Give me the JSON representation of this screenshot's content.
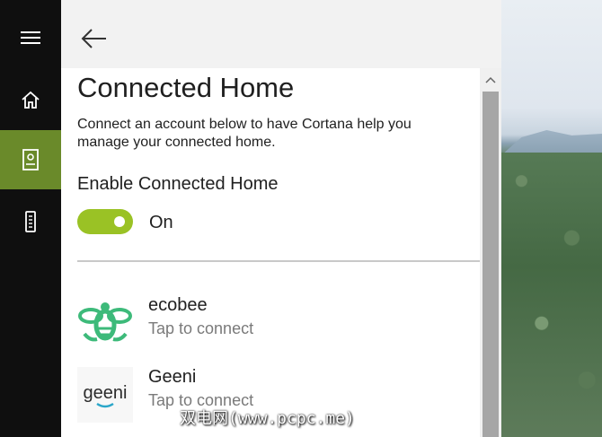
{
  "rail": {
    "items": [
      {
        "icon": "hamburger-menu-icon"
      },
      {
        "icon": "home-icon"
      },
      {
        "icon": "notebook-icon",
        "active": true
      },
      {
        "icon": "phone-icon"
      }
    ],
    "active_color": "#6a8a2a"
  },
  "panel": {
    "back_icon": "back-arrow-icon",
    "title": "Connected Home",
    "description": "Connect an account below to have Cortana help you manage your connected home.",
    "enable_label": "Enable Connected Home",
    "toggle": {
      "on": true,
      "state_label": "On",
      "color": "#9ac225"
    },
    "services": [
      {
        "name": "ecobee",
        "action": "Tap to connect",
        "logo_icon": "ecobee-bee-logo"
      },
      {
        "name": "Geeni",
        "action": "Tap to connect",
        "logo_icon": "geeni-logo",
        "logo_text": "geeni"
      }
    ]
  },
  "scrollbar": {
    "up_icon": "scroll-up-arrow-icon"
  },
  "watermark": "双电网(www.pcpc.me)"
}
